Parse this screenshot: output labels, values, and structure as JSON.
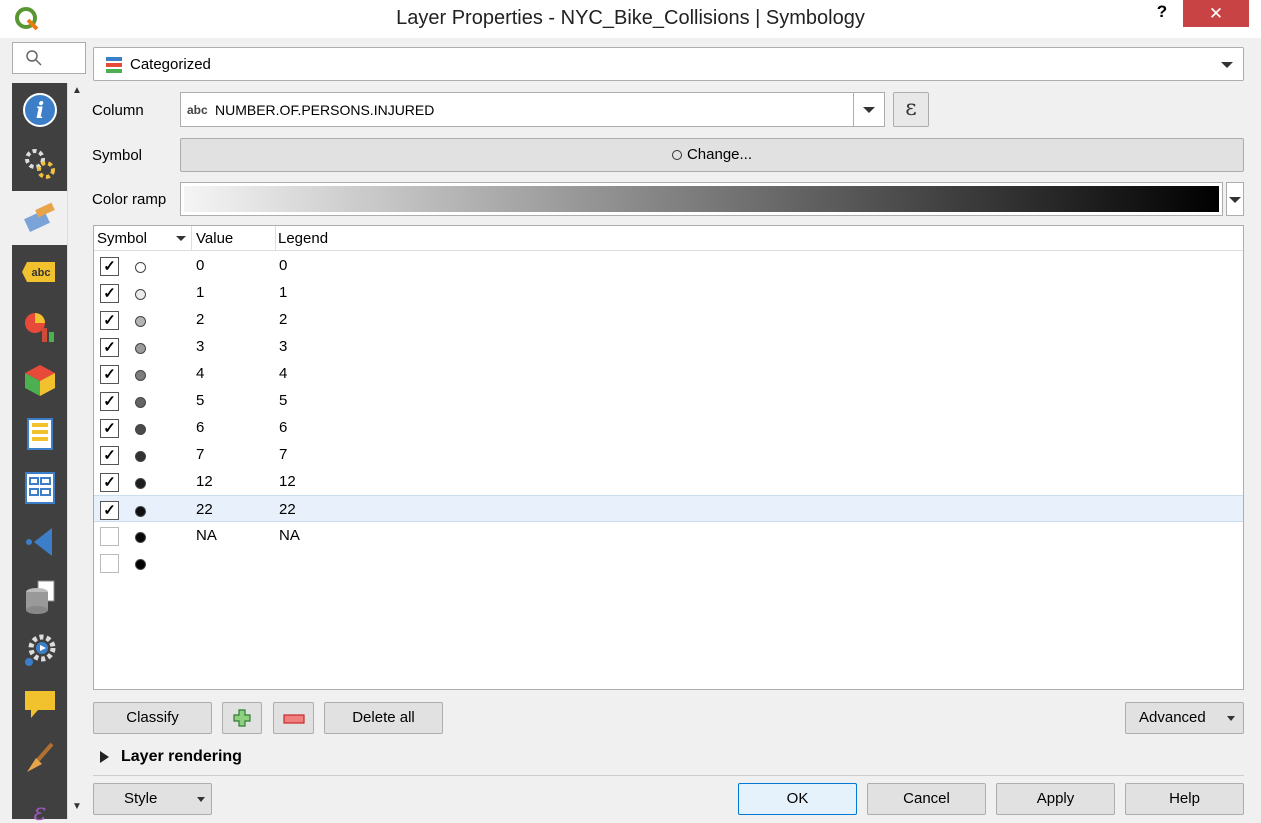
{
  "window": {
    "title": "Layer Properties - NYC_Bike_Collisions | Symbology",
    "help_label": "?",
    "close_label": "✕"
  },
  "renderer": {
    "selected": "Categorized"
  },
  "column": {
    "label": "Column",
    "type_tag": "abc",
    "value": "NUMBER.OF.PERSONS.INJURED",
    "expression_label": "ε"
  },
  "symbol": {
    "label": "Symbol",
    "button_label": "Change..."
  },
  "color_ramp": {
    "label": "Color ramp",
    "start": "#f5f5f5",
    "end": "#000000"
  },
  "table": {
    "headers": [
      "Symbol",
      "Value",
      "Legend"
    ],
    "rows": [
      {
        "checked": true,
        "value": "0",
        "legend": "0",
        "color": "#ffffff"
      },
      {
        "checked": true,
        "value": "1",
        "legend": "1",
        "color": "#ebebeb"
      },
      {
        "checked": true,
        "value": "2",
        "legend": "2",
        "color": "#b4b4b4"
      },
      {
        "checked": true,
        "value": "3",
        "legend": "3",
        "color": "#9b9b9b"
      },
      {
        "checked": true,
        "value": "4",
        "legend": "4",
        "color": "#7d7d7d"
      },
      {
        "checked": true,
        "value": "5",
        "legend": "5",
        "color": "#646464"
      },
      {
        "checked": true,
        "value": "6",
        "legend": "6",
        "color": "#4b4b4b"
      },
      {
        "checked": true,
        "value": "7",
        "legend": "7",
        "color": "#323232"
      },
      {
        "checked": true,
        "value": "12",
        "legend": "12",
        "color": "#1e1e1e"
      },
      {
        "checked": true,
        "value": "22",
        "legend": "22",
        "color": "#0f0f0f"
      },
      {
        "checked": false,
        "value": "NA",
        "legend": "NA",
        "color": "#080808"
      },
      {
        "checked": false,
        "value": "",
        "legend": "",
        "color": "#000000"
      }
    ],
    "selected_row": "22"
  },
  "buttons": {
    "classify": "Classify",
    "delete_all": "Delete all",
    "advanced": "Advanced",
    "style": "Style",
    "ok": "OK",
    "cancel": "Cancel",
    "apply": "Apply",
    "help": "Help"
  },
  "sections": {
    "layer_rendering": "Layer rendering"
  },
  "sidebar": {
    "items": [
      "information-icon",
      "source-icon",
      "symbology-icon",
      "labels-icon",
      "diagrams-icon",
      "3d-view-icon",
      "fields-icon",
      "attributes-form-icon",
      "joins-icon",
      "auxiliary-storage-icon",
      "actions-icon",
      "display-icon",
      "rendering-icon",
      "variables-icon"
    ]
  }
}
